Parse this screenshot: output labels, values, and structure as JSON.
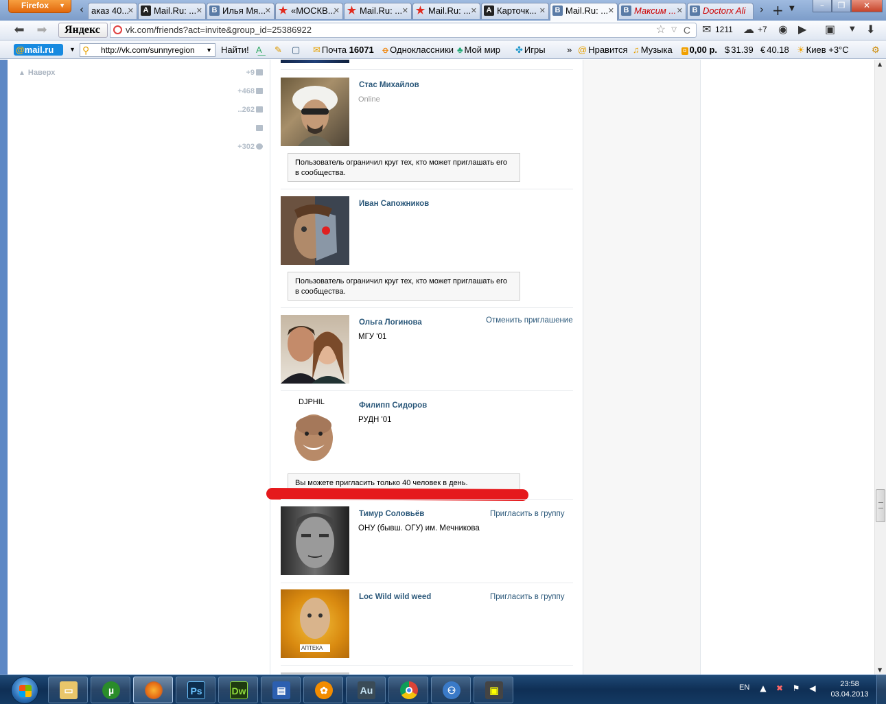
{
  "browser": {
    "menu_button": "Firefox",
    "tabs": [
      {
        "label": "аказ 40...",
        "icon": "none"
      },
      {
        "label": "Mail.Ru: ...",
        "icon": "mail-a"
      },
      {
        "label": "Илья Мя...",
        "icon": "vk"
      },
      {
        "label": "«МОСКВ...",
        "icon": "star"
      },
      {
        "label": "Mail.Ru: ...",
        "icon": "star"
      },
      {
        "label": "Mail.Ru: ...",
        "icon": "star"
      },
      {
        "label": "Карточк...",
        "icon": "mail-a"
      },
      {
        "label": "Mail.Ru: ...",
        "icon": "vk",
        "active": true
      },
      {
        "label": "Максим ...",
        "icon": "vk",
        "red": true
      },
      {
        "label": "Doctorx Ali",
        "icon": "vk",
        "red": true
      }
    ],
    "yandex_label": "Яндекс",
    "url": "vk.com/friends?act=invite&group_id=25386922",
    "mail_count": "1211",
    "weather_delta": "+7"
  },
  "mail_toolbar": {
    "search_value": "http://vk.com/sunnyregion",
    "find_button": "Найти!",
    "mail_label": "Почта",
    "mail_count": "16071",
    "odnoklassniki": "Одноклассники",
    "my_world": "Мой мир",
    "games": "Игры",
    "overflow": "»",
    "like": "Нравится",
    "music": "Музыка",
    "balance": "0,00 р.",
    "usd": "31.39",
    "eur": "40.18",
    "weather": "Киев +3°C"
  },
  "sidebar": {
    "up_label": "Наверх",
    "counters": [
      "+9",
      "+468",
      "..262",
      "",
      "+302"
    ]
  },
  "friends": [
    {
      "name": "Стас Михайлов",
      "sub": "Online",
      "sub_grey": true,
      "action": "",
      "notice": "Пользователь ограничил круг тех, кто может приглашать его в сообщества."
    },
    {
      "name": "Иван Сапожников",
      "sub": "",
      "action": "",
      "notice": "Пользователь ограничил круг тех, кто может приглашать его в сообщества."
    },
    {
      "name": "Ольга Логинова",
      "sub": "МГУ '01",
      "action": "Отменить приглашение",
      "notice": ""
    },
    {
      "name": "Филипп Сидоров",
      "sub": "РУДН '01",
      "action": "",
      "notice": "Вы можете пригласить только 40 человек в день.",
      "avatar_text": "DJPHIL"
    },
    {
      "name": "Тимур Соловьёв",
      "sub": "ОНУ (бывш. ОГУ) им. Мечникова",
      "action": "Пригласить в группу",
      "notice": ""
    },
    {
      "name": "Loc Wild wild weed",
      "sub": "",
      "action": "Пригласить в группу",
      "notice": "",
      "avatar_text": "АПТЕКА"
    }
  ],
  "taskbar": {
    "apps": [
      "explorer",
      "utorrent",
      "firefox",
      "photoshop",
      "dreamweaver",
      "save",
      "fl-studio",
      "audition",
      "chrome",
      "network",
      "gadget"
    ],
    "app_labels": {
      "ps": "Ps",
      "dw": "Dw",
      "au": "Au"
    },
    "lang": "EN",
    "time": "23:58",
    "date": "03.04.2013"
  }
}
